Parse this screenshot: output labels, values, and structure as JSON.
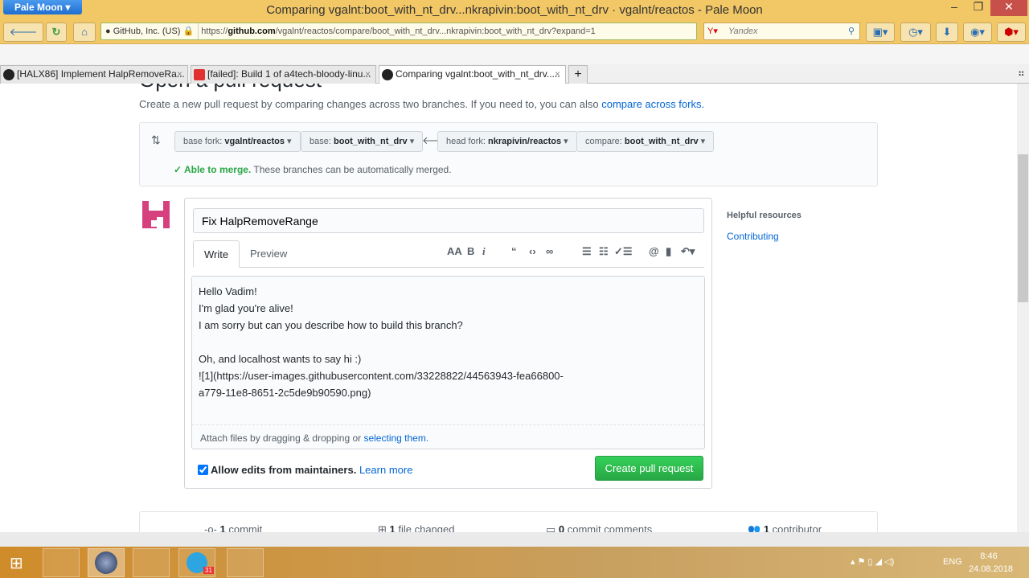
{
  "browser": {
    "app_button": "Pale Moon",
    "window_title": "Comparing vgalnt:boot_with_nt_drv...nkrapivin:boot_with_nt_drv · vgalnt/reactos - Pale Moon",
    "site_identity": "GitHub, Inc. (US)",
    "url_prefix": "https://",
    "url_domain": "github.com",
    "url_path": "/vgalnt/reactos/compare/boot_with_nt_drv...nkrapivin:boot_with_nt_drv?expand=1",
    "search_placeholder": "Yandex",
    "tabs": [
      {
        "label": "[HALX86] Implement HalpRemoveRa..."
      },
      {
        "label": "[failed]: Build 1 of a4tech-bloody-linu..."
      },
      {
        "label": "Comparing vgalnt:boot_with_nt_drv....."
      }
    ]
  },
  "page": {
    "heading": "Open a pull request",
    "subtitle": "Create a new pull request by comparing changes across two branches. If you need to, you can also ",
    "subtitle_link": "compare across forks.",
    "range": {
      "base_fork_label": "base fork: ",
      "base_fork": "vgalnt/reactos",
      "base_label": "base: ",
      "base": "boot_with_nt_drv",
      "head_fork_label": "head fork: ",
      "head_fork": "nkrapivin/reactos",
      "compare_label": "compare: ",
      "compare": "boot_with_nt_drv",
      "merge_ok": "Able to merge.",
      "merge_text": " These branches can be automatically merged."
    },
    "form": {
      "title_value": "Fix HalpRemoveRange",
      "tab_write": "Write",
      "tab_preview": "Preview",
      "body_value": "Hello Vadim!\nI'm glad you're alive!\nI am sorry but can you describe how to build this branch?\n\nOh, and localhost wants to say hi :)\n![1](https://user-images.githubusercontent.com/33228822/44563943-fea66800-\na779-11e8-8651-2c5de9b90590.png)",
      "attach_text": "Attach files by dragging & dropping or ",
      "attach_link": "selecting them.",
      "allow_edits": "Allow edits from maintainers.",
      "allow_edits_checked": true,
      "learn_more": "Learn more",
      "create_button": "Create pull request"
    },
    "sidebar": {
      "heading": "Helpful resources",
      "link": "Contributing"
    },
    "stats": [
      {
        "count": "1",
        "label": " commit"
      },
      {
        "count": "1",
        "label": " file changed"
      },
      {
        "count": "0",
        "label": " commit comments"
      },
      {
        "count": "1",
        "label": " contributor"
      }
    ]
  },
  "taskbar": {
    "lang": "ENG",
    "time": "8:46",
    "date": "24.08.2018",
    "telegram_badge": "31"
  },
  "colors": {
    "titlebar": "#f2c766",
    "accent_green": "#28a745",
    "link": "#0366d6"
  }
}
